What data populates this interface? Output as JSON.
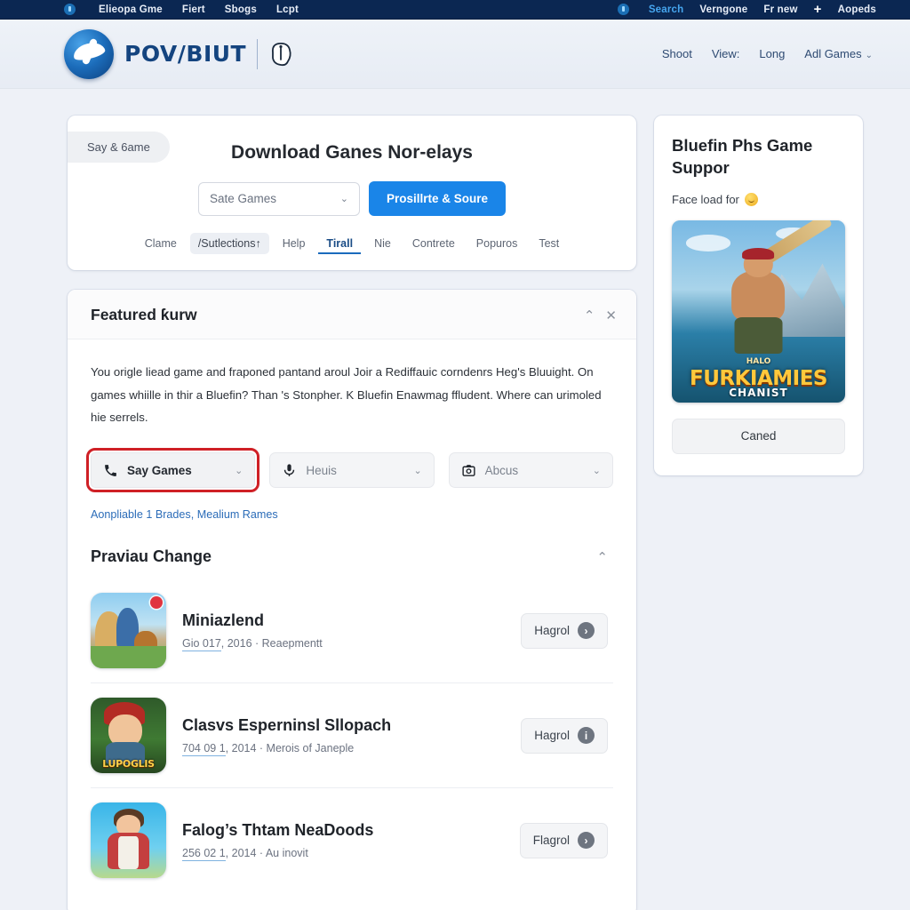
{
  "topbar": {
    "left_items": [
      "Elieopa Gme",
      "Fiert",
      "Sbogs",
      "Lcpt"
    ],
    "right_items": [
      "Search",
      "Verngone",
      "Fr new",
      "+",
      "Aopeds"
    ],
    "accent_color": "#46a6ef"
  },
  "header": {
    "brand_text": "POV/BIUT",
    "nav": [
      "Shoot",
      "View:",
      "Long",
      "Adl Games"
    ],
    "nav_caret": "⌄"
  },
  "search_card": {
    "pill_tab": "Say & 6ame",
    "title": "Download Ganes Nor-elays",
    "select_value": "Sate Games",
    "select_caret": "⌄",
    "primary_button": "Prosillrte & Soure",
    "tabs": [
      {
        "label": "Clame",
        "state": "normal"
      },
      {
        "label": "/Sutlections↑",
        "state": "selected"
      },
      {
        "label": "Help",
        "state": "normal"
      },
      {
        "label": "Tirall",
        "state": "active"
      },
      {
        "label": "Nie",
        "state": "normal"
      },
      {
        "label": "Contrete",
        "state": "normal"
      },
      {
        "label": "Popuros",
        "state": "normal"
      },
      {
        "label": "Test",
        "state": "normal"
      }
    ]
  },
  "featured": {
    "title": "Featured ƙurw",
    "collapse_icon": "⌃",
    "close_icon": "✕",
    "paragraph": "You origle liead game and fraponed pantand aroul Joir a Rediffauic corndenrs Heg's Bluuight. On games whiille in thir a Bluefin? Than 's Stonpher. K Bluefin Enawmag ffludent. Where can urimoled hie serrels.",
    "dropdowns": [
      {
        "label": "Say Games",
        "icon": "phone-icon",
        "highlighted": true,
        "caret": "⌄"
      },
      {
        "label": "Heuis",
        "icon": "microphone-icon",
        "highlighted": false,
        "caret": "⌄"
      },
      {
        "label": "Abcus",
        "icon": "camera-icon",
        "highlighted": false,
        "caret": "⌄"
      }
    ],
    "highlight_color": "#cf2026",
    "link_text": "Aonpliable 1 Brades, Mealium Rames",
    "link_color": "#2b6cb8"
  },
  "previous_change": {
    "title": "Praviau Change",
    "caret": "⌃",
    "items": [
      {
        "name": "Miniazlend",
        "date_part": "Gio 017",
        "rest": ", 2016 · Reaepmentt",
        "button_label": "Hagrol",
        "button_icon": "arrow-right-icon",
        "badge": true,
        "thumb_label": ""
      },
      {
        "name": "Clasvs Esperninsl Sllopach",
        "date_part": "704 09 1",
        "rest": ", 2014 · Merois of Janeple",
        "button_label": "Hagrol",
        "button_icon": "info-icon",
        "badge": false,
        "thumb_label": "LUPOGLIS"
      },
      {
        "name": "Falog’s Thtam NeaDoods",
        "date_part": "256 02 1",
        "rest": ", 2014 · Au inovit",
        "button_label": "Flagrol",
        "button_icon": "arrow-right-icon",
        "badge": false,
        "thumb_label": ""
      }
    ]
  },
  "sidebar": {
    "title": "Bluefin Phs Game Suppor",
    "subtitle": "Face load for",
    "emoji": "smiley-icon",
    "art": {
      "logo_main": "FURKIAMIES",
      "logo_sub": "CHANIST",
      "logo_top": "HALO"
    },
    "button_label": "Caned"
  }
}
